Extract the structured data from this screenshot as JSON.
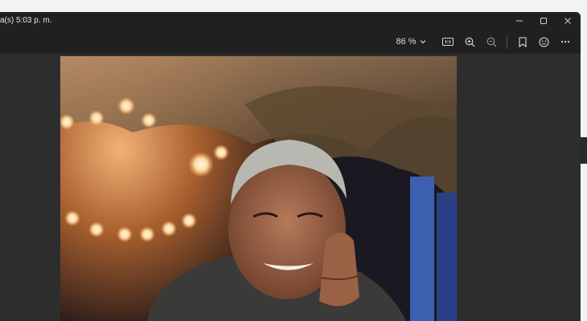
{
  "window": {
    "title": "a(s) 5:03 p. m."
  },
  "window_controls": {
    "minimize_icon": "minimize-icon",
    "maximize_icon": "maximize-icon",
    "close_icon": "close-icon"
  },
  "toolbar": {
    "zoom_value": "86 %",
    "icons": [
      "chevron-down-icon",
      "actual-size-icon",
      "zoom-in-icon",
      "zoom-out-icon",
      "bookmark-icon",
      "smiley-icon",
      "more-icon"
    ]
  },
  "colors": {
    "window_bg": "#202020",
    "viewer_bg": "#2d2d2d",
    "desktop_bg": "#f3f3f3"
  },
  "content": {
    "photo_icon": "portrait-photo"
  }
}
